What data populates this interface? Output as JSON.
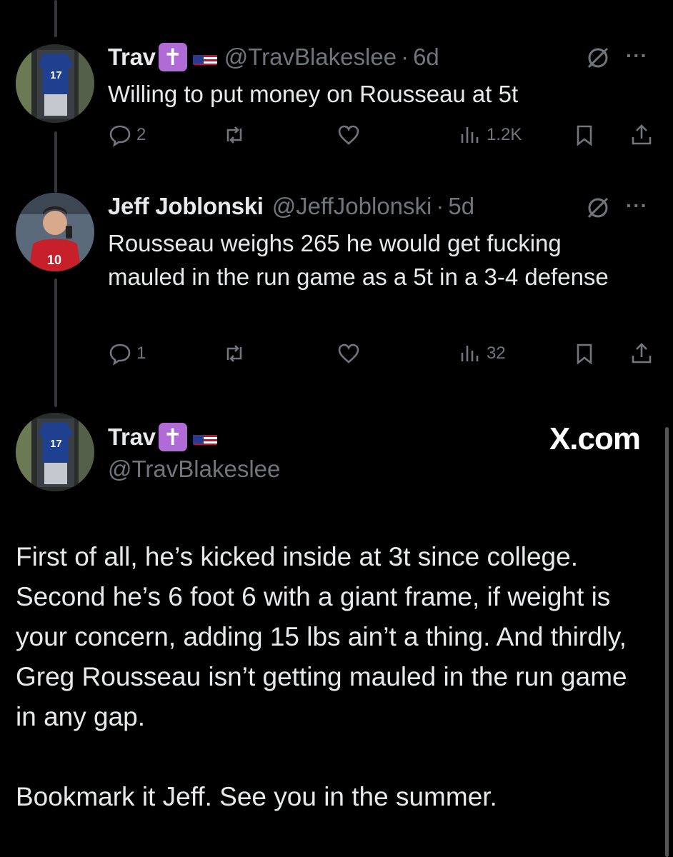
{
  "tweets": [
    {
      "name": "Trav",
      "badge_cross": "✝",
      "handle": "@TravBlakeslee",
      "separator": "·",
      "age": "6d",
      "text": "Willing to put money on Rousseau at 5t",
      "replies": "2",
      "views": "1.2K"
    },
    {
      "name": "Jeff Joblonski",
      "handle": "@JeffJoblonski",
      "separator": "·",
      "age": "5d",
      "text": "Rousseau weighs 265 he would get fucking mauled in the run game as a 5t in a 3-4 defense",
      "replies": "1",
      "views": "32"
    }
  ],
  "post": {
    "name": "Trav",
    "badge_cross": "✝",
    "handle": "@TravBlakeslee",
    "source": "X.com",
    "paragraph1": "First of all, he’s kicked inside at 3t since college. Second he’s 6 foot 6 with a giant frame, if weight is your concern, adding 15 lbs ain’t a thing. And thirdly, Greg Rousseau isn’t getting mauled in the run game in any gap.",
    "paragraph2": "Bookmark it Jeff. See you in the summer."
  },
  "more_glyph": "···",
  "icons": {
    "reply": "reply-icon",
    "repost": "repost-icon",
    "like": "like-icon",
    "views": "views-icon",
    "bookmark": "bookmark-icon",
    "share": "share-icon",
    "grok": "grok-icon",
    "more": "more-icon"
  },
  "colors": {
    "background": "#000000",
    "text": "#e7e9ea",
    "muted": "#71767b",
    "cross_badge": "#b06bd6"
  }
}
